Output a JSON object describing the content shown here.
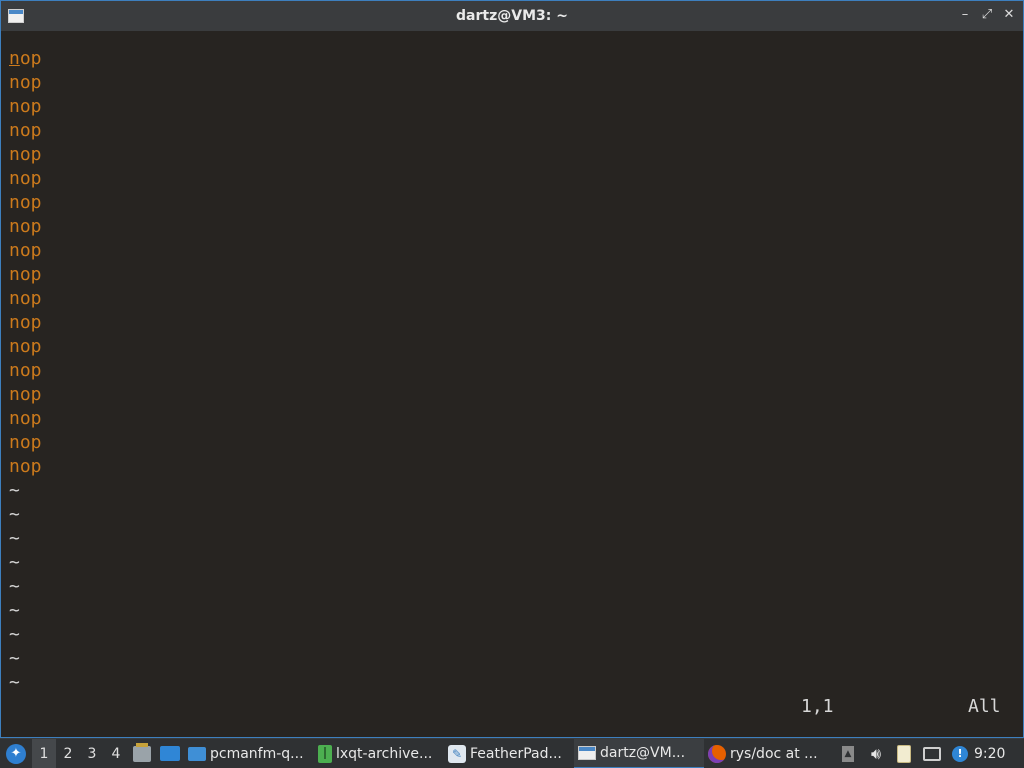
{
  "window": {
    "title": "dartz@VM3: ~",
    "controls": [
      "–",
      "⤢",
      "✕"
    ]
  },
  "terminal": {
    "lines": [
      "nop",
      "nop",
      "nop",
      "nop",
      "nop",
      "nop",
      "nop",
      "nop",
      "nop",
      "nop",
      "nop",
      "nop",
      "nop",
      "nop",
      "nop",
      "nop",
      "nop",
      "nop"
    ],
    "tildes": [
      "~",
      "~",
      "~",
      "~",
      "~",
      "~",
      "~",
      "~",
      "~"
    ],
    "status": {
      "position": "1,1",
      "scroll": "All"
    }
  },
  "taskbar": {
    "desktops": [
      "1",
      "2",
      "3",
      "4"
    ],
    "active_desktop": "1",
    "tasks": [
      {
        "label": "pcmanfm-q...",
        "icon": "folder-icon"
      },
      {
        "label": "lxqt-archive...",
        "icon": "archive-icon"
      },
      {
        "label": "FeatherPad...",
        "icon": "featherpad-icon"
      },
      {
        "label": "dartz@VM...",
        "icon": "terminal-icon"
      },
      {
        "label": "rys/doc at ...",
        "icon": "firefox-icon"
      }
    ],
    "clock": "9:20"
  },
  "colors": {
    "text_orange": "#cc7a1c",
    "terminal_bg": "#272421",
    "accent": "#3d7fbe"
  }
}
